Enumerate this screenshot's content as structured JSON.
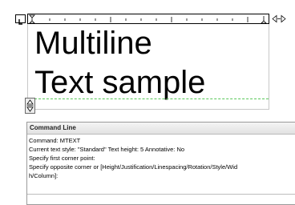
{
  "editor": {
    "lines": [
      "Multiline",
      "Text sample"
    ]
  },
  "ruler": {
    "tab_selector_icon": "left-tab-stop-icon",
    "width_arrows_icon": "ruler-width-arrows-icon"
  },
  "command_line": {
    "title": "Command Line",
    "history": [
      "Command: MTEXT",
      "Current text style:  \"Standard\"  Text height:  5  Annotative:  No",
      "Specify first corner point:",
      "Specify opposite corner or [Height/Justification/Linespacing/Rotation/Style/Wid",
      "h/Column]:"
    ],
    "input_value": ""
  },
  "colors": {
    "baseline": "#5ac85a",
    "border": "#c8c8c8"
  }
}
